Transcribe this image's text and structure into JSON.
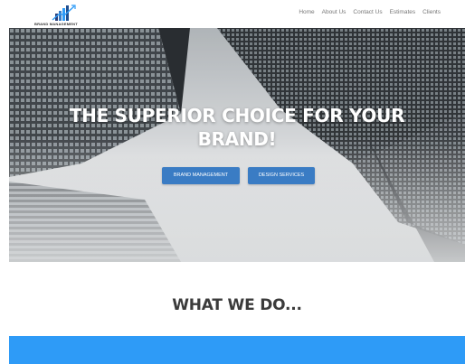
{
  "header": {
    "logo_text": "BRAND MANAGEMENT",
    "nav": [
      {
        "label": "Home"
      },
      {
        "label": "About Us"
      },
      {
        "label": "Contact Us"
      },
      {
        "label": "Estimates"
      },
      {
        "label": "Clients"
      }
    ]
  },
  "hero": {
    "title_line1": "THE SUPERIOR CHOICE FOR YOUR",
    "title_line2": "BRAND!",
    "buttons": [
      {
        "label": "BRAND MANAGEMENT"
      },
      {
        "label": "DESIGN SERVICES"
      }
    ]
  },
  "section": {
    "heading": "WHAT WE DO..."
  },
  "colors": {
    "accent_blue": "#2e9bf7",
    "button_blue": "#3a7cc4"
  }
}
